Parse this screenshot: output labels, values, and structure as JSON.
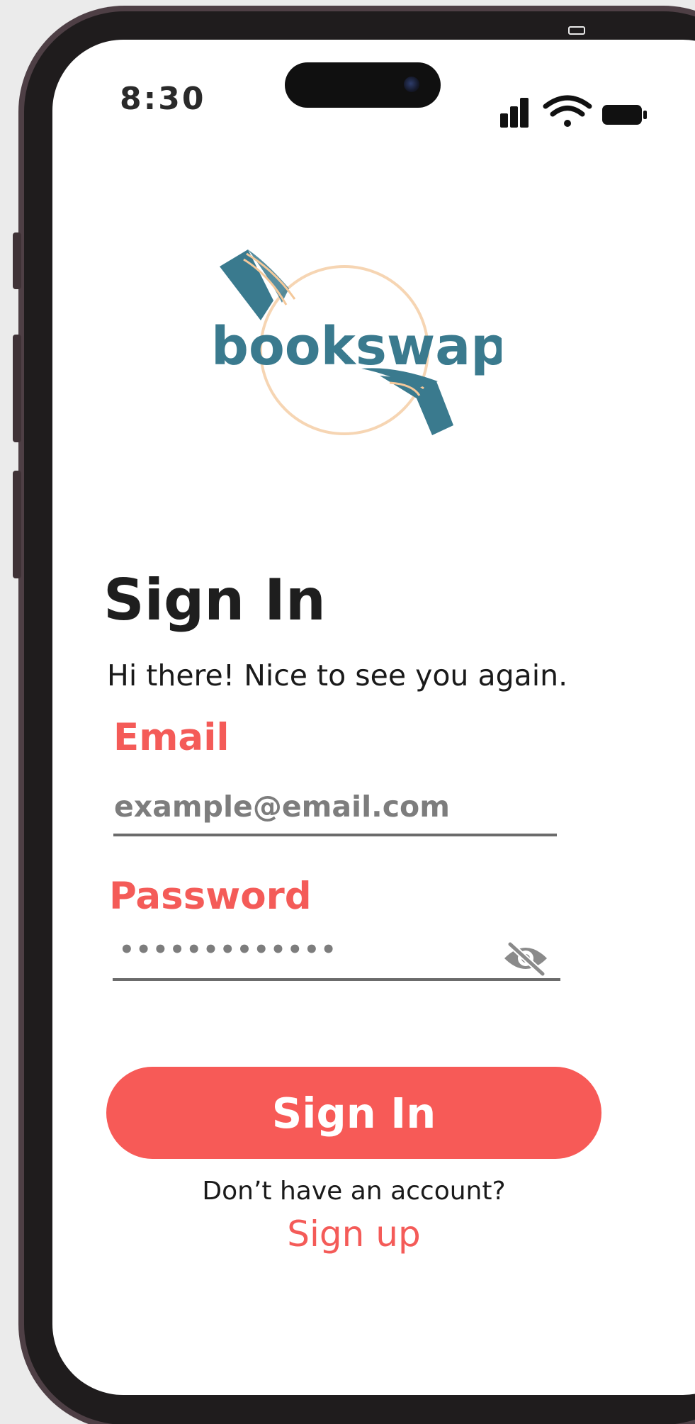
{
  "status_bar": {
    "time": "8:30",
    "icons": [
      "cellular-signal-icon",
      "wifi-icon",
      "battery-icon"
    ]
  },
  "logo": {
    "text": "bookswap",
    "icon": "book-swap-logo",
    "colors": {
      "primary": "#3a7a8e",
      "accent": "#f4c89a"
    }
  },
  "header": {
    "title": "Sign In",
    "subtitle": "Hi there! Nice to see you again."
  },
  "form": {
    "email": {
      "label": "Email",
      "placeholder": "example@email.com",
      "value": ""
    },
    "password": {
      "label": "Password",
      "value": "•••••••••••••",
      "visibility_icon": "eye-off-icon"
    },
    "submit_label": "Sign In"
  },
  "footer": {
    "prompt": "Don’t have an account?",
    "signup_label": "Sign up"
  },
  "colors": {
    "accent": "#f75a57",
    "label": "#f45b58",
    "text": "#1e1e1e",
    "input_text": "#7d7d7d"
  }
}
